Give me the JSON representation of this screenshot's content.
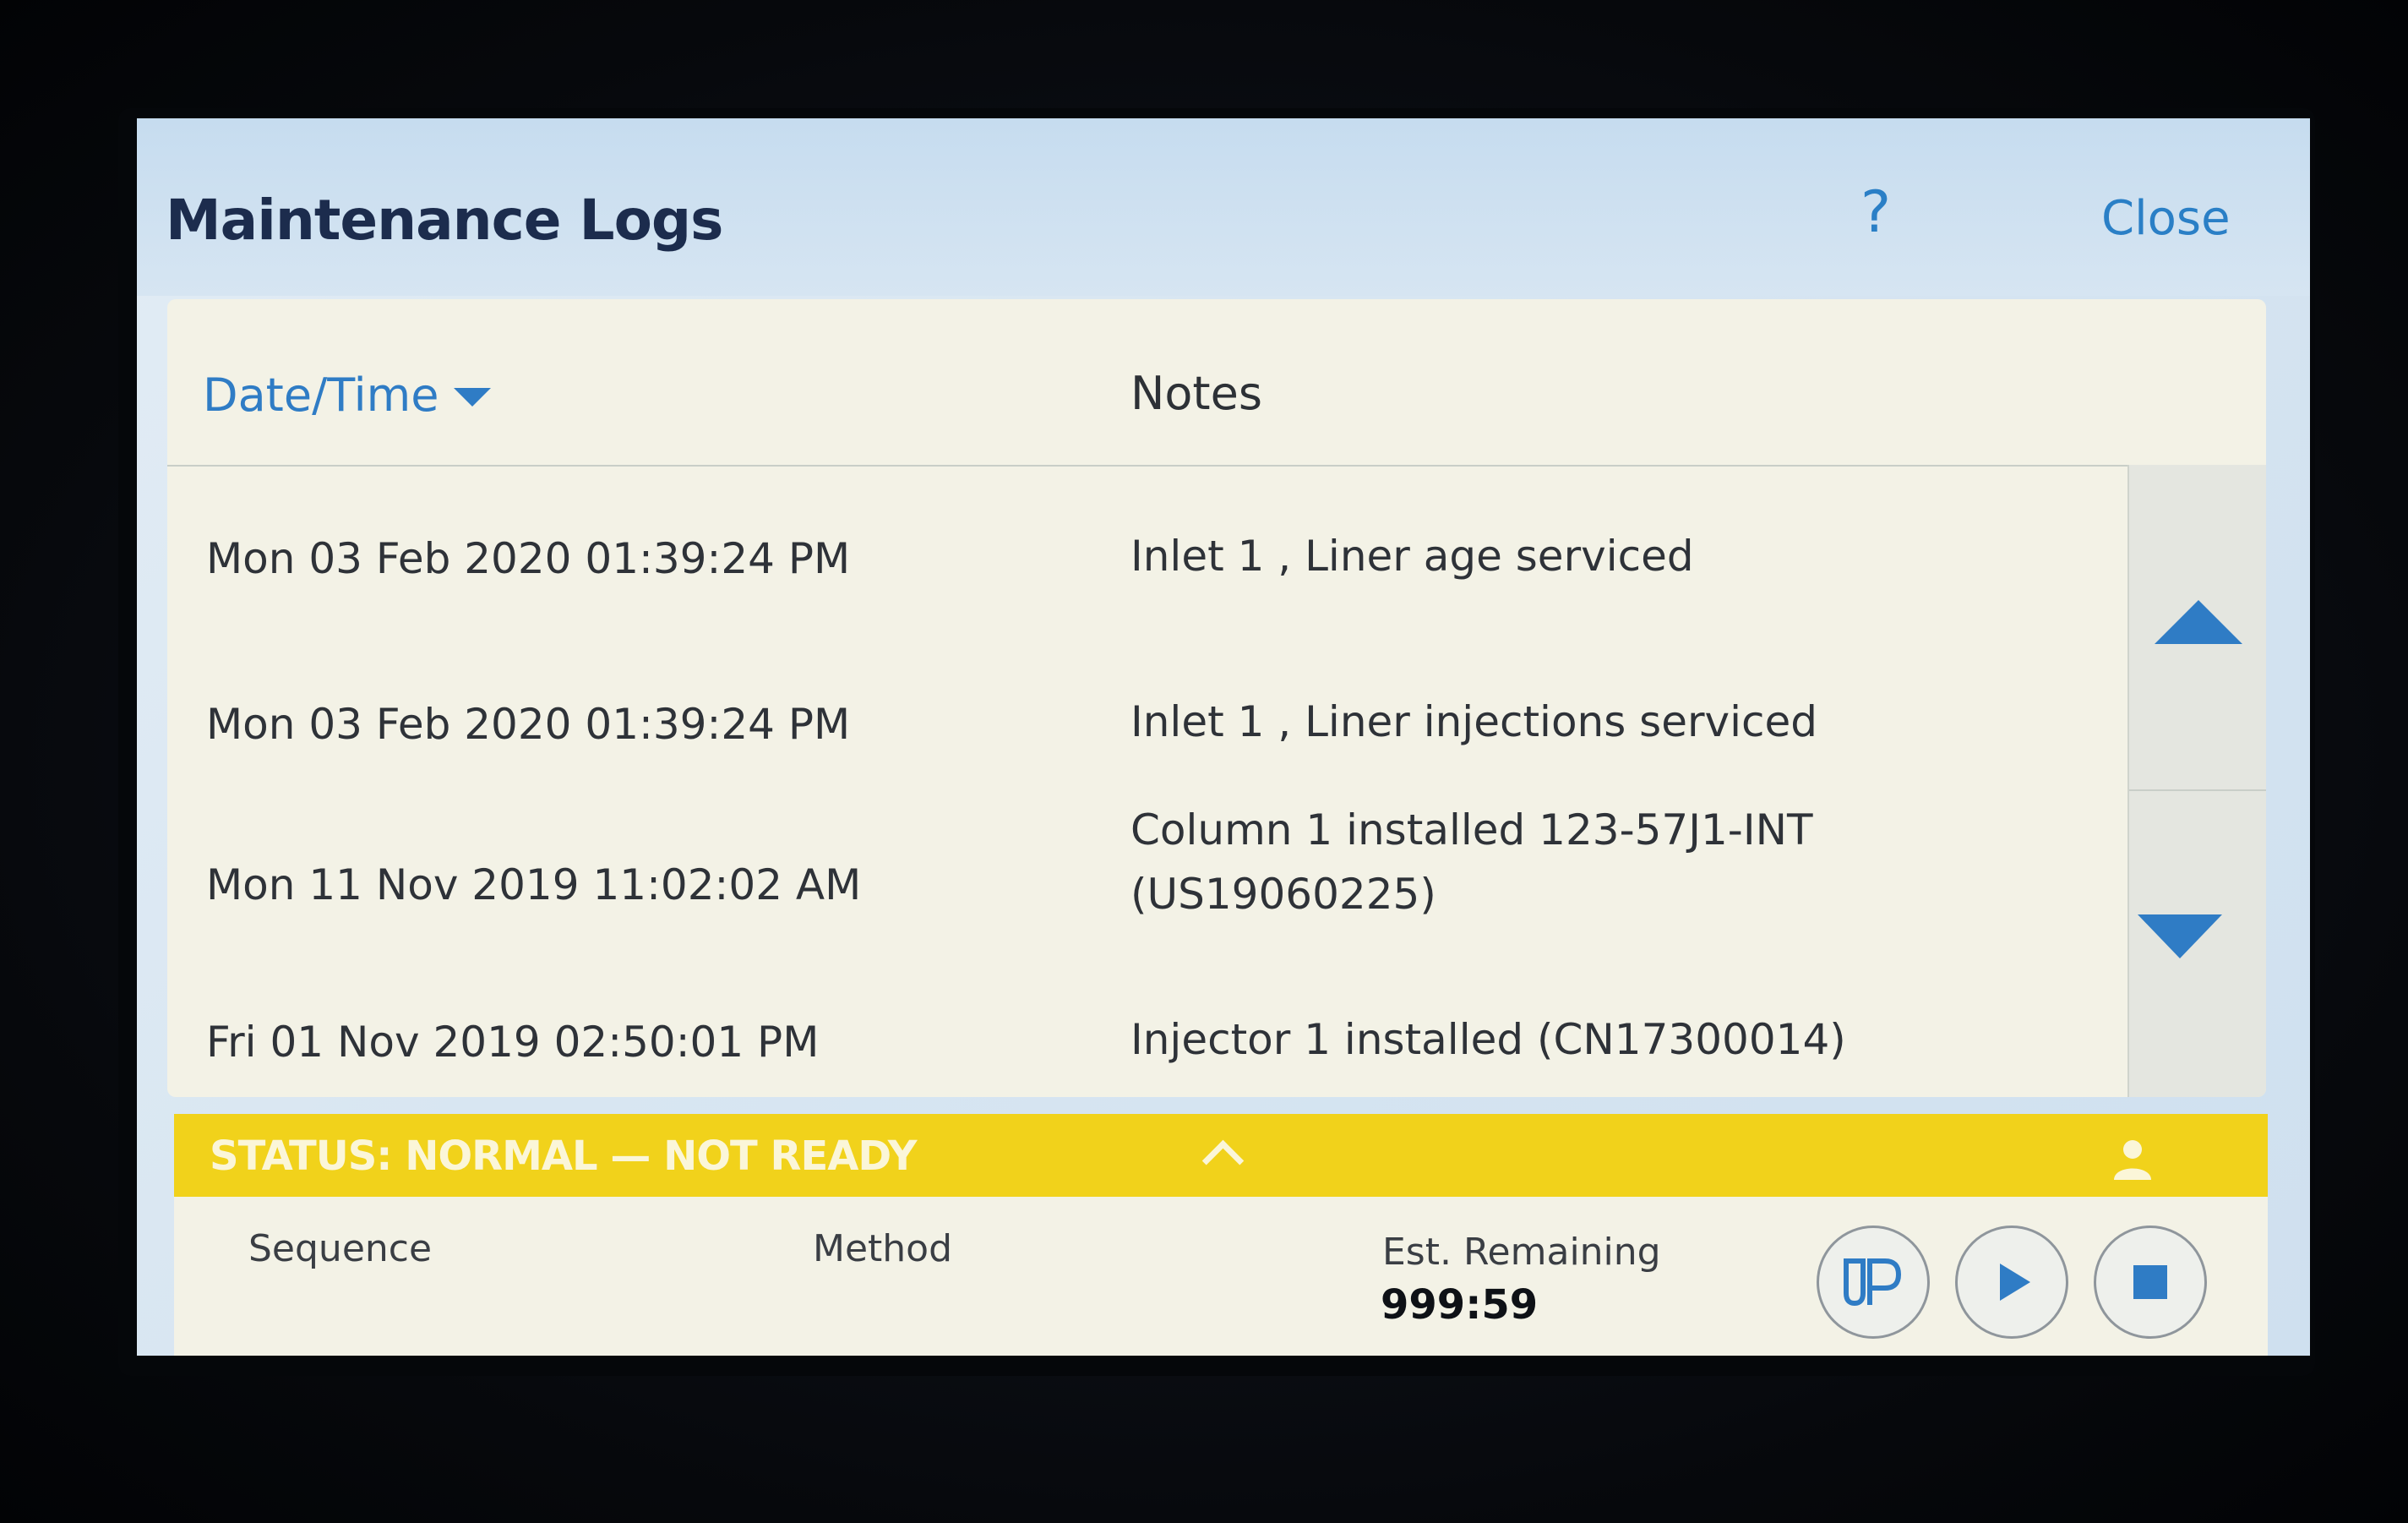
{
  "header": {
    "title": "Maintenance Logs",
    "help_label": "?",
    "close_label": "Close"
  },
  "table": {
    "columns": [
      {
        "label": "Date/Time",
        "sorted": "descending"
      },
      {
        "label": "Notes"
      }
    ],
    "rows": [
      {
        "datetime": "Mon 03 Feb 2020 01:39:24 PM",
        "notes": [
          "Inlet 1 , Liner age serviced"
        ]
      },
      {
        "datetime": "Mon 03 Feb 2020 01:39:24 PM",
        "notes": [
          "Inlet 1 , Liner injections serviced"
        ]
      },
      {
        "datetime": "Mon 11 Nov 2019 11:02:02 AM",
        "notes": [
          "Column 1 installed 123-57J1-INT",
          "(US19060225)"
        ]
      },
      {
        "datetime": "Fri 01 Nov 2019 02:50:01 PM",
        "notes": [
          "Injector 1 installed (CN17300014)"
        ]
      }
    ],
    "scroll_icons": [
      "scroll-up-icon",
      "scroll-down-icon"
    ]
  },
  "status": {
    "text": "STATUS: NORMAL — NOT READY",
    "color": "#f1d21b"
  },
  "footer": {
    "sequence_label": "Sequence",
    "method_label": "Method",
    "est_remaining_label": "Est. Remaining",
    "est_remaining_value": "999:59",
    "buttons": [
      "prep-run-icon",
      "play-icon",
      "stop-icon"
    ]
  },
  "colors": {
    "accent": "#2f7cc5",
    "title": "#1c2c4d",
    "status_bar": "#f1d21b"
  }
}
